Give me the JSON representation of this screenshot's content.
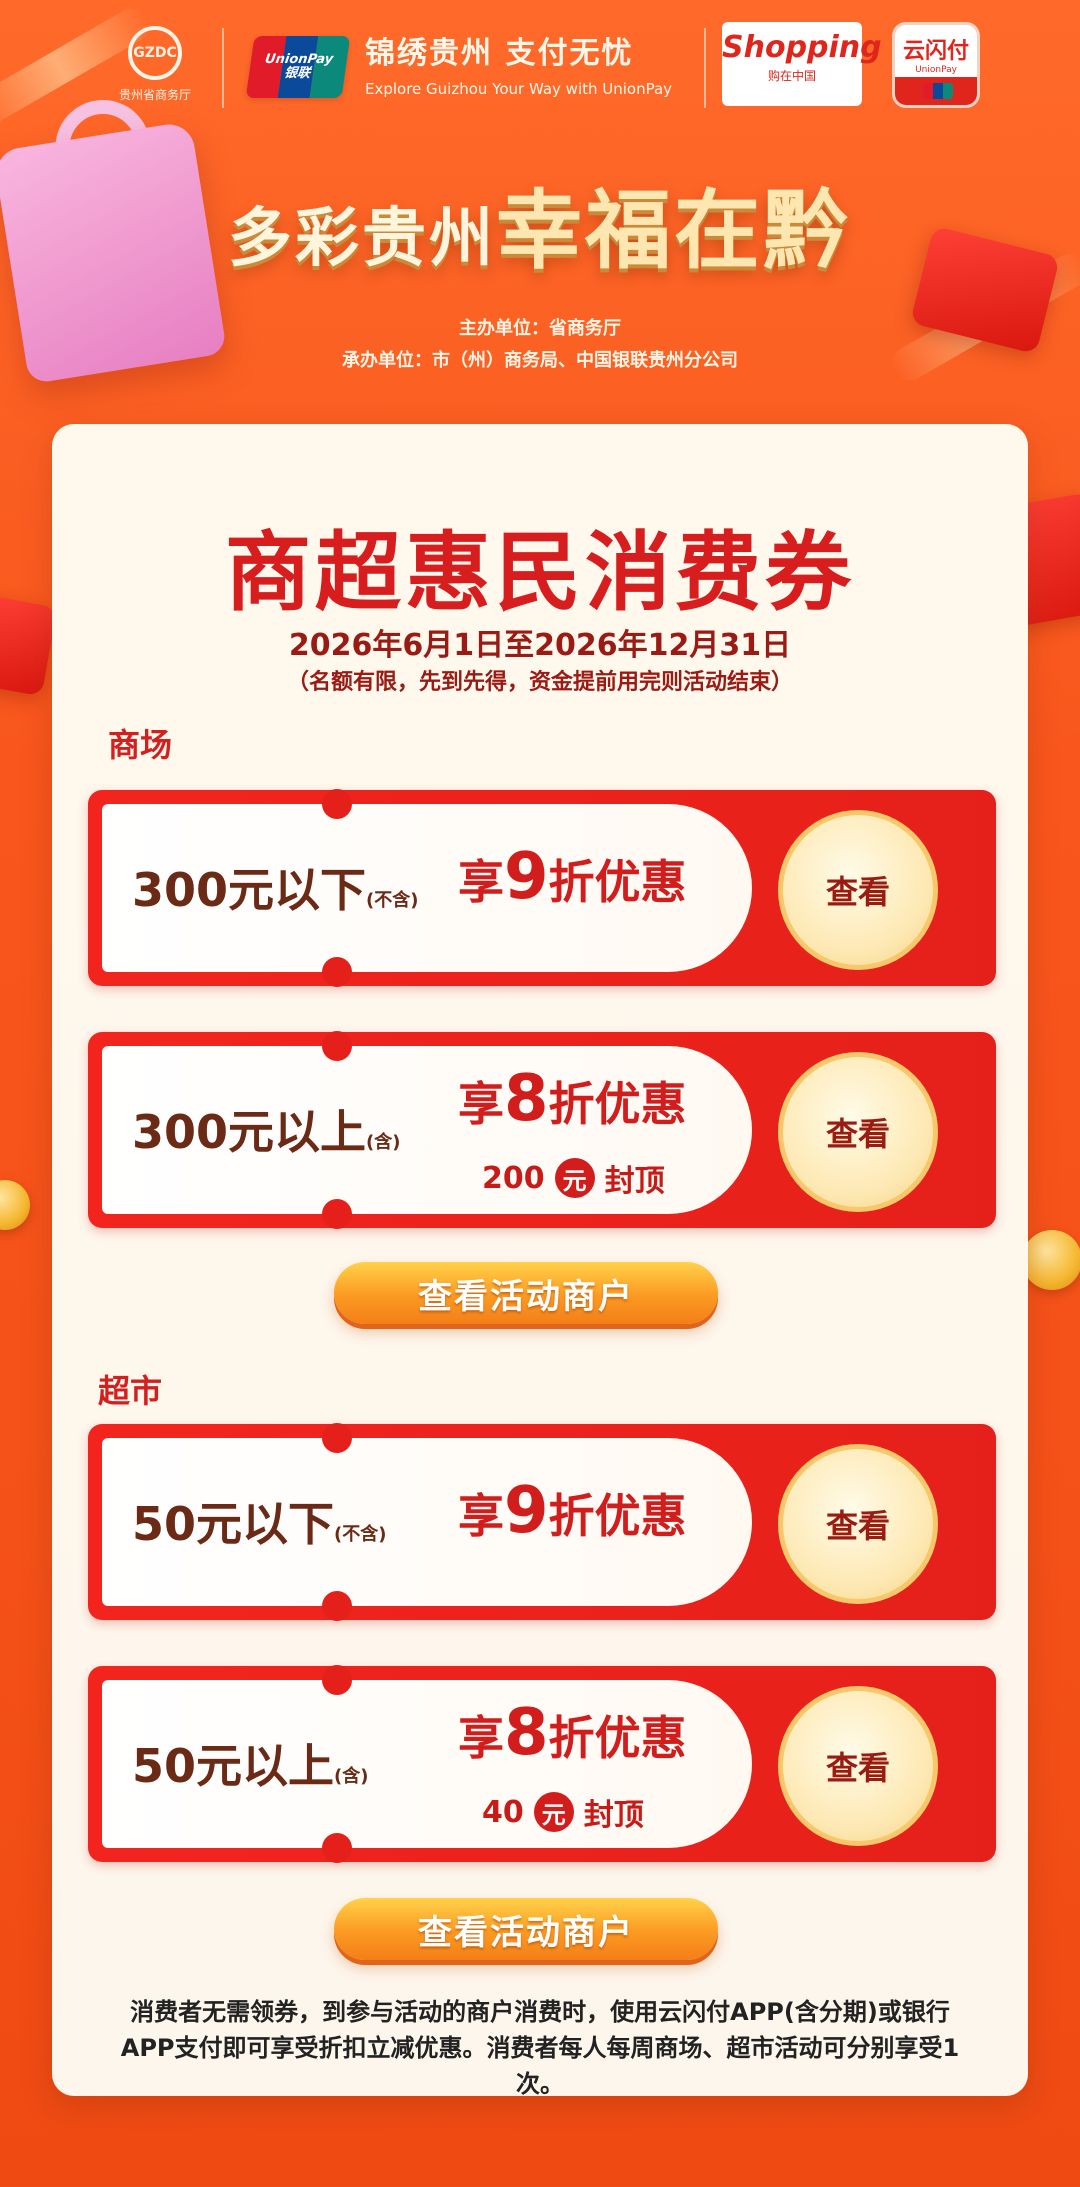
{
  "header": {
    "gzdc_logo_text": "GZDC",
    "gzdc_caption": "贵州省商务厅",
    "unionpay_en": "UnionPay",
    "unionpay_cn": "银联",
    "slogan_cn": "锦绣贵州  支付无忧",
    "slogan_en": "Explore Guizhou Your Way with UnionPay",
    "shopping_main": "Shopping",
    "shopping_sub": "购在中国",
    "ysf_main": "云闪付",
    "ysf_sub": "UnionPay"
  },
  "campaign": {
    "title_part1": "多彩贵州",
    "title_part2": "幸福在黔",
    "sponsor": "主办单位：省商务厅",
    "organizer": "承办单位：市（州）商务局、中国银联贵州分公司"
  },
  "card": {
    "title": "商超惠民消费券",
    "date": "2026年6月1日至2026年12月31日",
    "note": "（名额有限，先到先得，资金提前用完则活动结束）"
  },
  "mall": {
    "label": "商场",
    "coupons": [
      {
        "amount": "300元以下",
        "qualifier": "(不含)",
        "prefix": "享",
        "discount": "9",
        "suffix": "折优惠",
        "cap_value": "",
        "cap_unit": "",
        "cap_text": "",
        "button": "查看"
      },
      {
        "amount": "300元以上",
        "qualifier": "(含)",
        "prefix": "享",
        "discount": "8",
        "suffix": "折优惠",
        "cap_value": "200",
        "cap_unit": "元",
        "cap_text": "封顶",
        "button": "查看"
      }
    ],
    "merchant_button": "查看活动商户"
  },
  "supermarket": {
    "label": "超市",
    "coupons": [
      {
        "amount": "50元以下",
        "qualifier": "(不含)",
        "prefix": "享",
        "discount": "9",
        "suffix": "折优惠",
        "cap_value": "",
        "cap_unit": "",
        "cap_text": "",
        "button": "查看"
      },
      {
        "amount": "50元以上",
        "qualifier": "(含)",
        "prefix": "享",
        "discount": "8",
        "suffix": "折优惠",
        "cap_value": "40",
        "cap_unit": "元",
        "cap_text": "封顶",
        "button": "查看"
      }
    ],
    "merchant_button": "查看活动商户"
  },
  "footer": {
    "note": "消费者无需领券，到参与活动的商户消费时，使用云闪付APP(含分期)或银行APP支付即可享受折扣立减优惠。消费者每人每周商场、超市活动可分别享受1次。"
  },
  "colors": {
    "accent_red": "#d71d1d",
    "background_orange": "#f8561c",
    "gold": "#f6c86b"
  }
}
